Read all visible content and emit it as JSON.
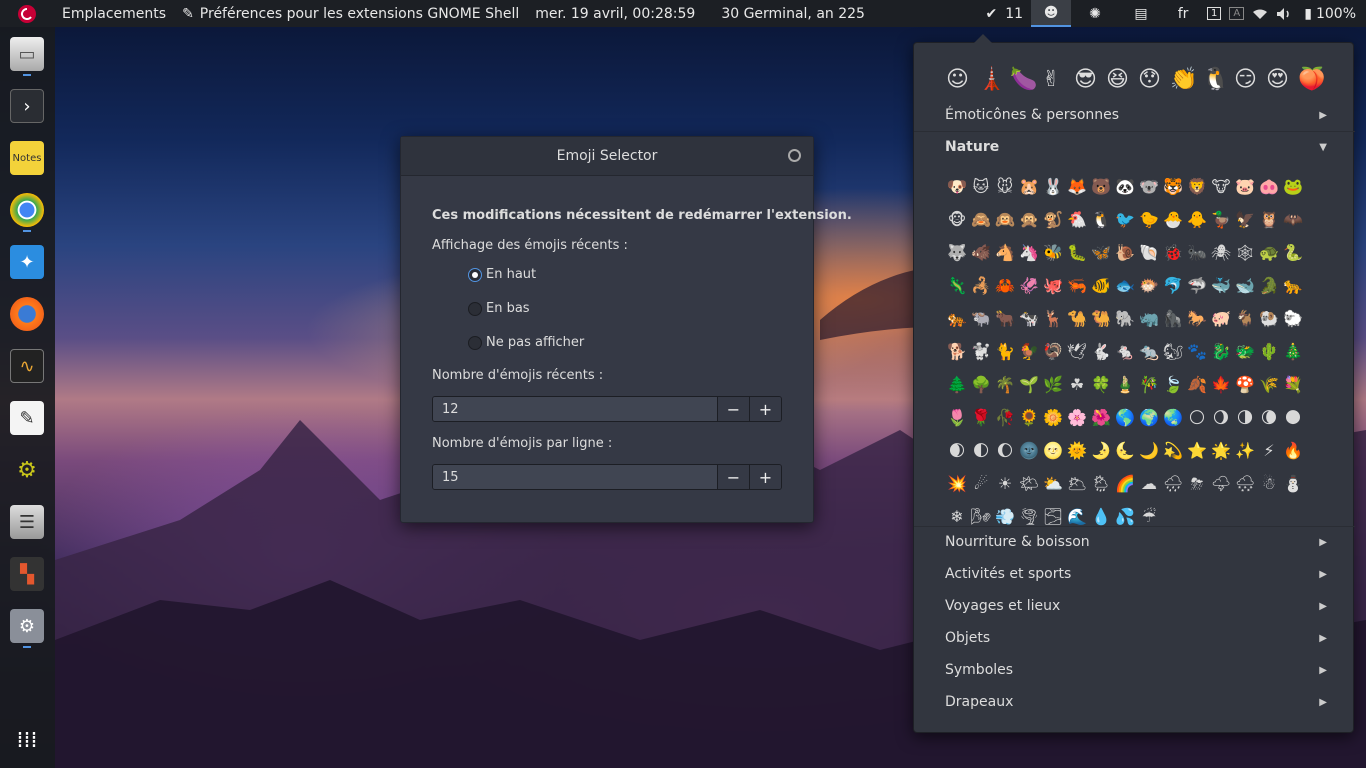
{
  "topbar": {
    "places": "Emplacements",
    "app_title": "Préférences pour les extensions GNOME Shell",
    "datetime": "mer. 19 avril, 00:28:59",
    "republican_date": "30 Germinal, an 225",
    "todo_count": "11",
    "keyboard_layout": "fr",
    "battery": "100%"
  },
  "dock": {
    "apps": [
      "files-icon",
      "terminal-icon",
      "notes-icon",
      "chrome-icon",
      "safari-icon",
      "firefox-icon",
      "system-monitor-icon",
      "text-editor-icon",
      "robot-icon",
      "mixer-icon",
      "tetris-icon",
      "settings-icon"
    ],
    "show_apps_icon": "grid-icon"
  },
  "dialog": {
    "title": "Emoji Selector",
    "notice": "Ces modifications nécessitent de redémarrer l'extension.",
    "recent_label": "Affichage des émojis récents :",
    "options": [
      "En haut",
      "En bas",
      "Ne pas afficher"
    ],
    "selected_option": "En haut",
    "recent_count_label": "Nombre d'émojis récents :",
    "recent_count_value": "12",
    "per_line_label": "Nombre d'émojis par ligne :",
    "per_line_value": "15",
    "minus": "−",
    "plus": "+"
  },
  "emoji_menu": {
    "recent": [
      "☺",
      "🗼",
      "🍆",
      "✌",
      "😎",
      "😆",
      "😯",
      "👏",
      "🐧",
      "😏",
      "😍",
      "🍑"
    ],
    "categories": [
      {
        "label": "Émoticônes & personnes",
        "expanded": false
      },
      {
        "label": "Nature",
        "expanded": true
      },
      {
        "label": "Nourriture & boisson",
        "expanded": false
      },
      {
        "label": "Activités et sports",
        "expanded": false
      },
      {
        "label": "Voyages et lieux",
        "expanded": false
      },
      {
        "label": "Objets",
        "expanded": false
      },
      {
        "label": "Symboles",
        "expanded": false
      },
      {
        "label": "Drapeaux",
        "expanded": false
      }
    ],
    "arrow_collapsed": "▶",
    "arrow_expanded": "▼",
    "nature": [
      "🐶",
      "🐱",
      "🐭",
      "🐹",
      "🐰",
      "🦊",
      "🐻",
      "🐼",
      "🐨",
      "🐯",
      "🦁",
      "🐮",
      "🐷",
      "🐽",
      "🐸",
      "🐵",
      "🙈",
      "🙉",
      "🙊",
      "🐒",
      "🐔",
      "🐧",
      "🐦",
      "🐤",
      "🐣",
      "🐥",
      "🦆",
      "🦅",
      "🦉",
      "🦇",
      "🐺",
      "🐗",
      "🐴",
      "🦄",
      "🐝",
      "🐛",
      "🦋",
      "🐌",
      "🐚",
      "🐞",
      "🐜",
      "🕷",
      "🕸",
      "🐢",
      "🐍",
      "🦎",
      "🦂",
      "🦀",
      "🦑",
      "🐙",
      "🦐",
      "🐠",
      "🐟",
      "🐡",
      "🐬",
      "🦈",
      "🐳",
      "🐋",
      "🐊",
      "🐆",
      "🐅",
      "🐃",
      "🐂",
      "🐄",
      "🦌",
      "🐪",
      "🐫",
      "🐘",
      "🦏",
      "🦍",
      "🐎",
      "🐖",
      "🐐",
      "🐏",
      "🐑",
      "🐕",
      "🐩",
      "🐈",
      "🐓",
      "🦃",
      "🕊",
      "🐇",
      "🐁",
      "🐀",
      "🐿",
      "🐾",
      "🐉",
      "🐲",
      "🌵",
      "🎄",
      "🌲",
      "🌳",
      "🌴",
      "🌱",
      "🌿",
      "☘",
      "🍀",
      "🎍",
      "🎋",
      "🍃",
      "🍂",
      "🍁",
      "🍄",
      "🌾",
      "💐",
      "🌷",
      "🌹",
      "🥀",
      "🌻",
      "🌼",
      "🌸",
      "🌺",
      "🌎",
      "🌍",
      "🌏",
      "🌕",
      "🌖",
      "🌗",
      "🌘",
      "🌑",
      "🌒",
      "🌓",
      "🌔",
      "🌚",
      "🌝",
      "🌞",
      "🌛",
      "🌜",
      "🌙",
      "💫",
      "⭐",
      "🌟",
      "✨",
      "⚡",
      "🔥",
      "💥",
      "☄",
      "☀",
      "🌤",
      "⛅",
      "🌥",
      "🌦",
      "🌈",
      "☁",
      "🌧",
      "⛈",
      "🌩",
      "🌨",
      "☃",
      "⛄",
      "❄",
      "🌬",
      "💨",
      "🌪",
      "🌫",
      "🌊",
      "💧",
      "💦",
      "☔"
    ]
  }
}
